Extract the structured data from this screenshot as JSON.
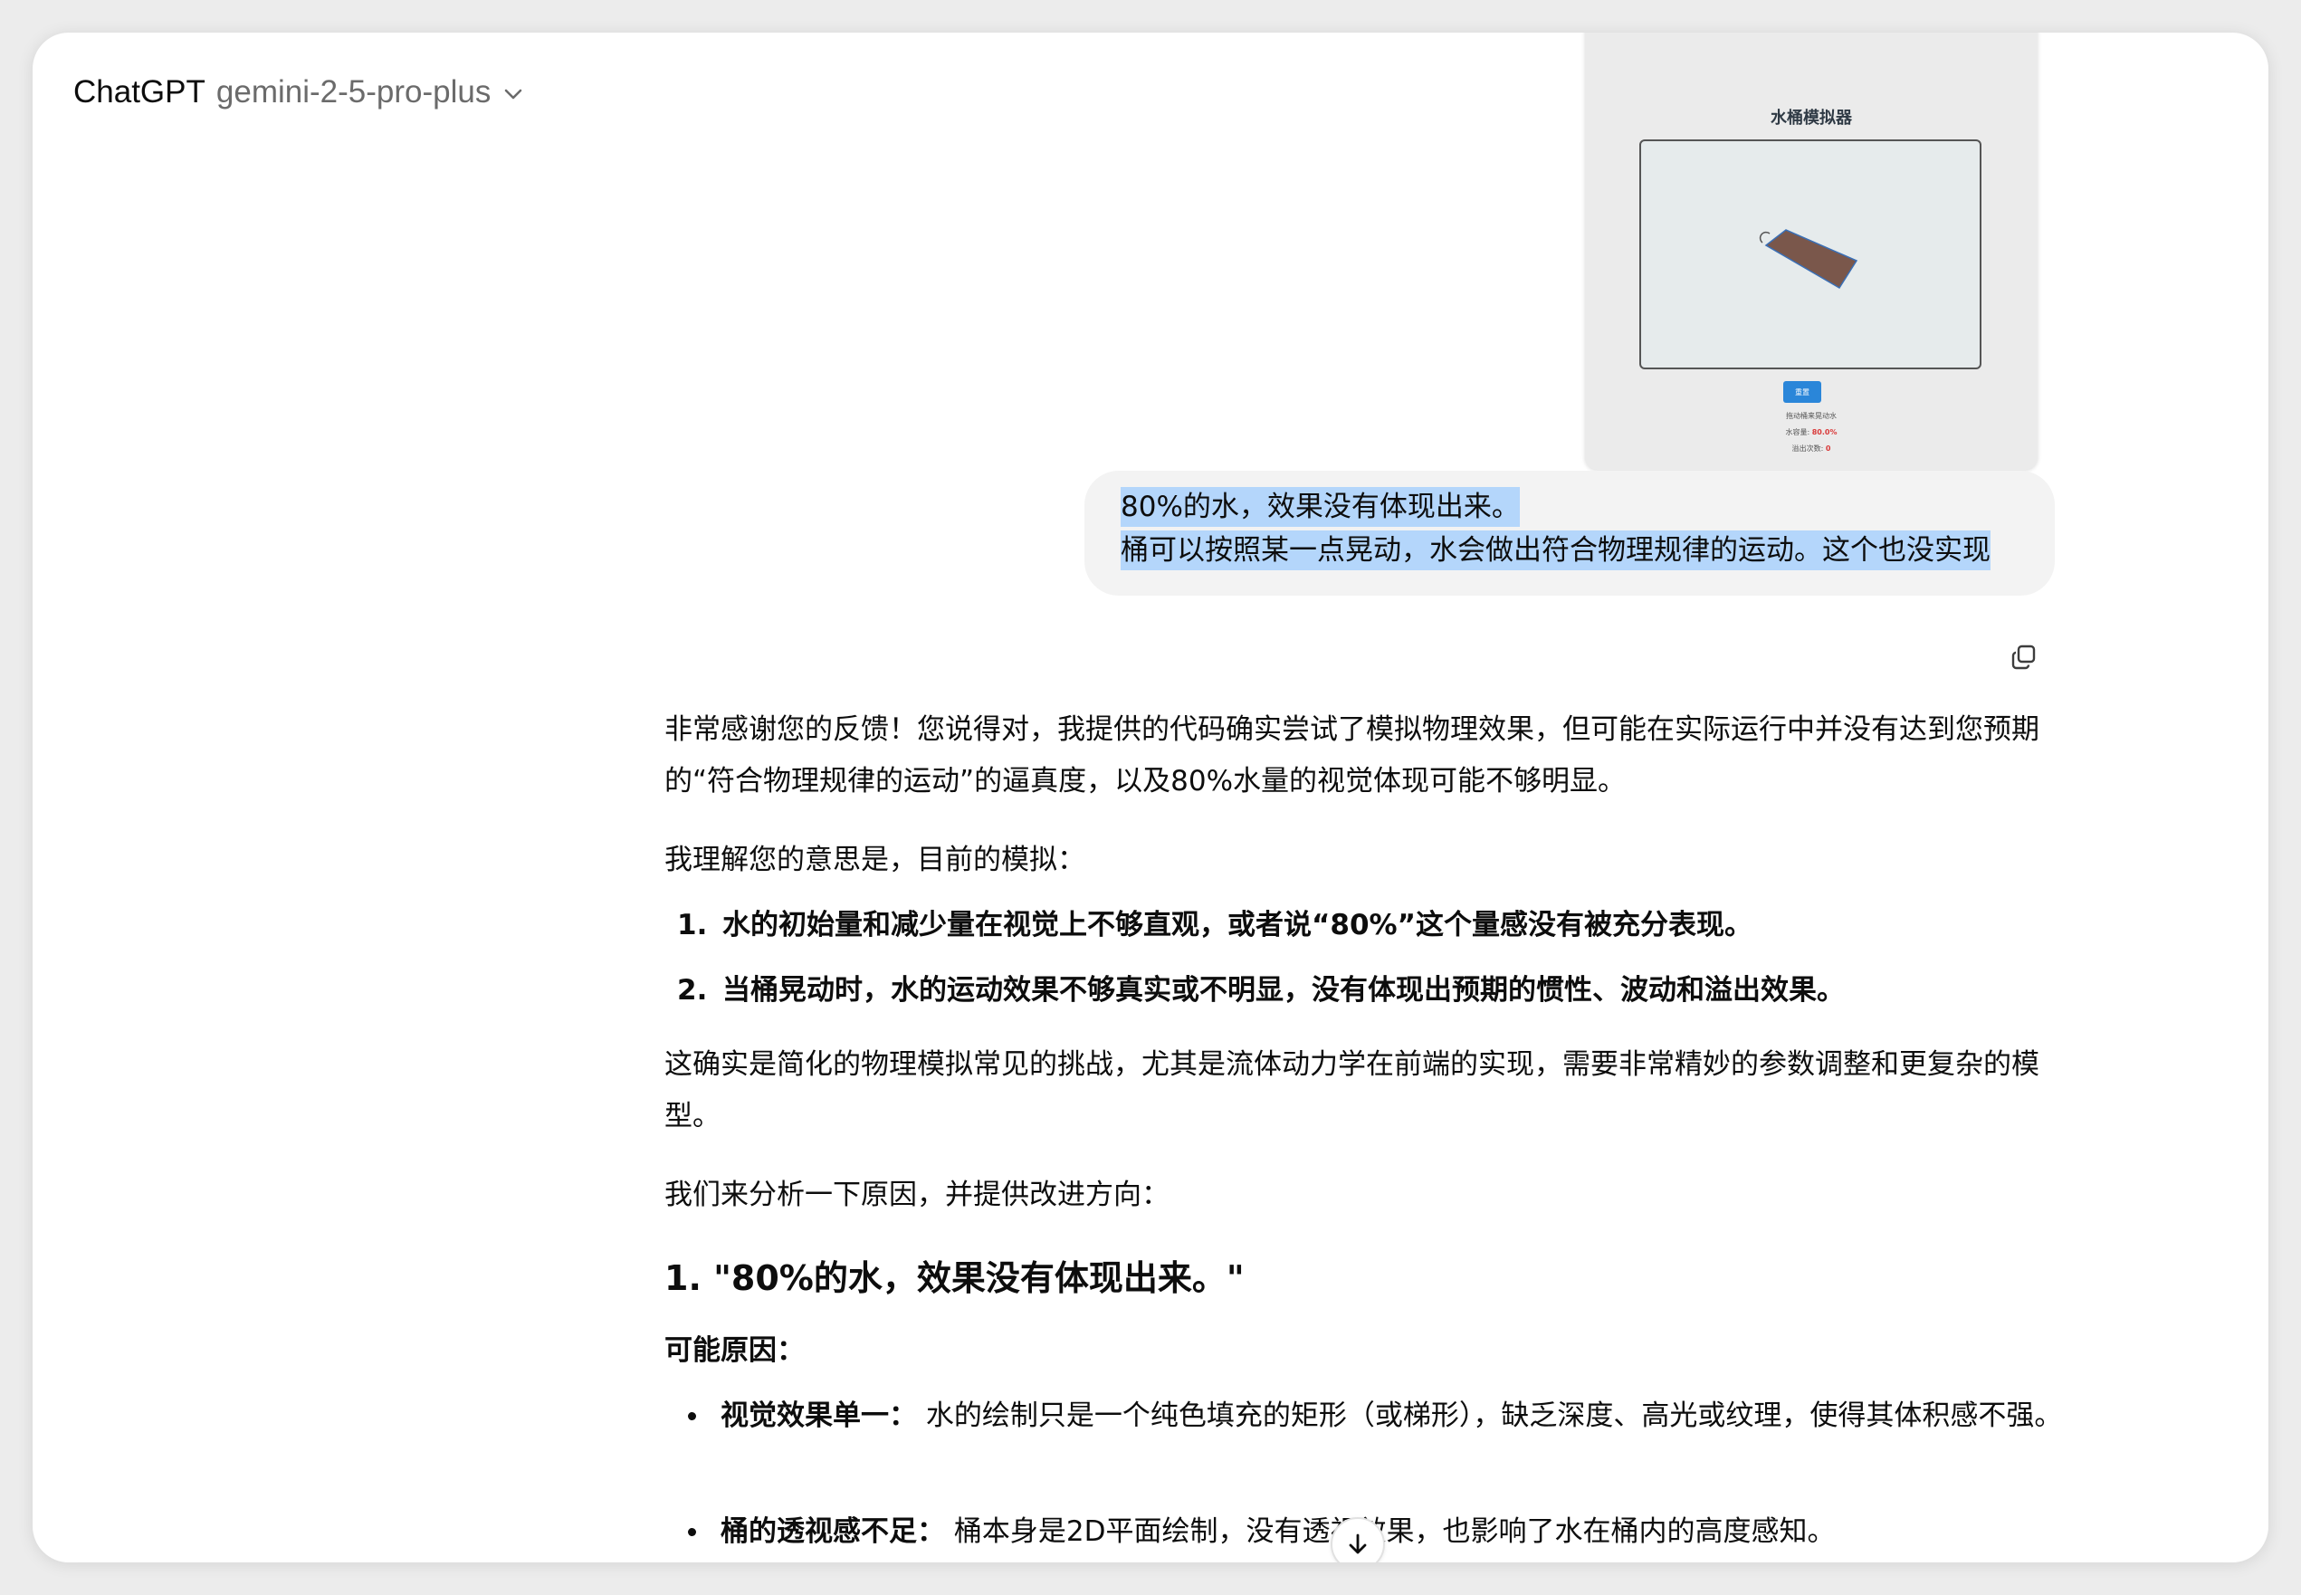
{
  "header": {
    "app_name": "ChatGPT",
    "model_name": "gemini-2-5-pro-plus",
    "model_menu_icon": "chevron-down-icon"
  },
  "attachment": {
    "title": "水桶模拟器",
    "reset_button": "重置",
    "hint": "拖动桶来晃动水",
    "water_label": "水容量: ",
    "water_value": "80.0%",
    "overflow_label": "溢出次数: ",
    "overflow_value": "0"
  },
  "user_message": {
    "line1": "80%的水，效果没有体现出来。",
    "line2": "桶可以按照某一点晃动，水会做出符合物理规律的运动。这个也没实现"
  },
  "actions": {
    "copy_icon": "copy-icon"
  },
  "assistant": {
    "p1": "非常感谢您的反馈！您说得对，我提供的代码确实尝试了模拟物理效果，但可能在实际运行中并没有达到您预期的“符合物理规律的运动”的逼真度，以及80%水量的视觉体现可能不够明显。",
    "p2": "我理解您的意思是，目前的模拟：",
    "list": [
      {
        "num": "1.",
        "text": "水的初始量和减少量在视觉上不够直观，或者说“80%”这个量感没有被充分表现。"
      },
      {
        "num": "2.",
        "text": "当桶晃动时，水的运动效果不够真实或不明显，没有体现出预期的惯性、波动和溢出效果。"
      }
    ],
    "p3": "这确实是简化的物理模拟常见的挑战，尤其是流体动力学在前端的实现，需要非常精妙的参数调整和更复杂的模型。",
    "p4": "我们来分析一下原因，并提供改进方向：",
    "h1": "1. \"80%的水，效果没有体现出来。\"",
    "causes_label": "可能原因：",
    "bullets": [
      {
        "label": "视觉效果单一：",
        "text": " 水的绘制只是一个纯色填充的矩形（或梯形），缺乏深度、高光或纹理，使得其体积感不强。"
      },
      {
        "label": "桶的透视感不足：",
        "text": " 桶本身是2D平面绘制，没有透视效果，也影响了水在桶内的高度感知。"
      }
    ]
  },
  "scroll": {
    "icon": "arrow-down-icon"
  }
}
